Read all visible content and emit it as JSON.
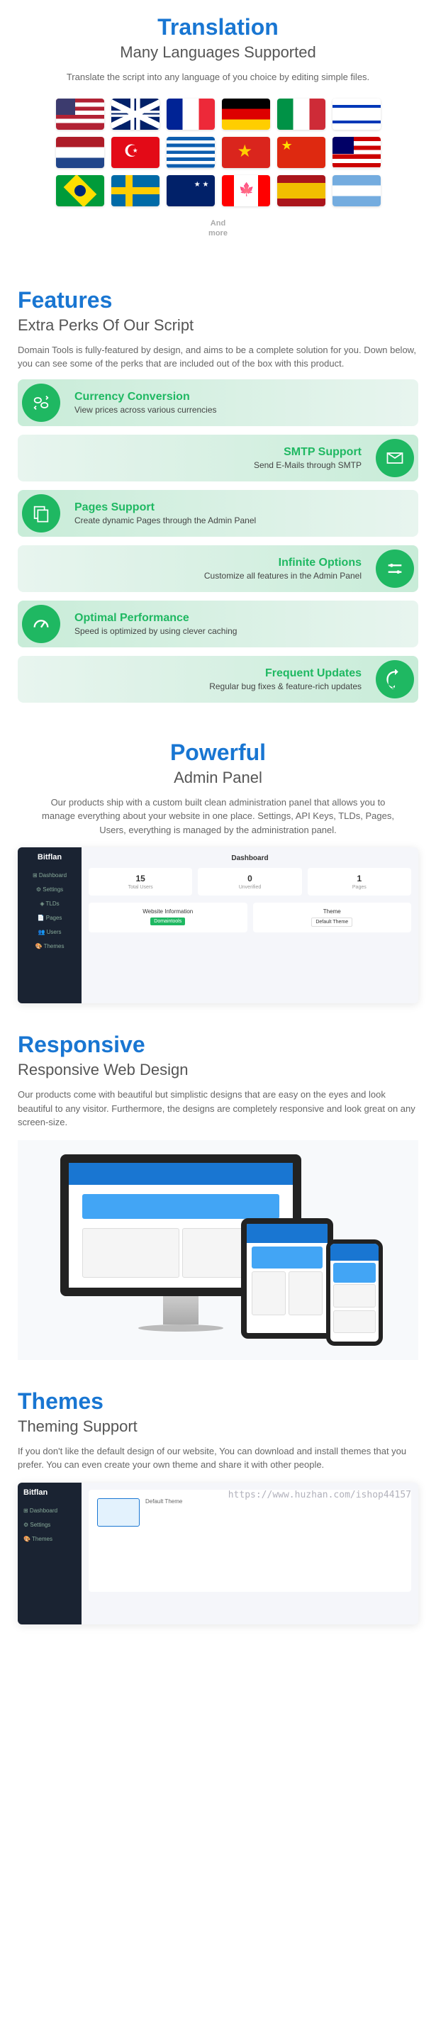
{
  "translation": {
    "title": "Translation",
    "subtitle": "Many Languages Supported",
    "desc": "Translate the script into any language of you choice by editing simple files.",
    "more1": "And",
    "more2": "more"
  },
  "features": {
    "title": "Features",
    "subtitle": "Extra Perks Of Our Script",
    "desc": "Domain Tools is fully-featured by design, and aims to be a complete solution for you. Down below, you can see some of the perks that are included out of the box with this product.",
    "items": [
      {
        "title": "Currency Conversion",
        "sub": "View prices across various currencies"
      },
      {
        "title": "SMTP Support",
        "sub": "Send E-Mails through SMTP"
      },
      {
        "title": "Pages Support",
        "sub": "Create dynamic Pages through the Admin Panel"
      },
      {
        "title": "Infinite Options",
        "sub": "Customize all features in the Admin Panel"
      },
      {
        "title": "Optimal Performance",
        "sub": "Speed is optimized by using clever caching"
      },
      {
        "title": "Frequent Updates",
        "sub": "Regular bug fixes & feature-rich updates"
      }
    ]
  },
  "powerful": {
    "title": "Powerful",
    "subtitle": "Admin Panel",
    "desc": "Our products ship with a custom built clean administration panel that allows you to manage everything about your website in one place. Settings, API Keys, TLDs, Pages, Users, everything is managed by the administration panel.",
    "logo": "Bitflan",
    "header": "Dashboard",
    "cards": [
      {
        "value": "15",
        "label": "Total Users"
      },
      {
        "value": "0",
        "label": "Unverified"
      },
      {
        "value": "1",
        "label": "Pages"
      }
    ],
    "box1_title": "Website Information",
    "box1_badge": "Domaintools",
    "box2_title": "Theme",
    "box2_badge": "Default Theme"
  },
  "responsive": {
    "title": "Responsive",
    "subtitle": "Responsive Web Design",
    "desc": "Our products come with beautiful but simplistic designs that are easy on the eyes and look beautiful to any visitor. Furthermore, the designs are completely responsive and look great on any screen-size."
  },
  "themes": {
    "title": "Themes",
    "subtitle": "Theming Support",
    "desc": "If you don't like the default design of our website, You can download and install themes that you prefer. You can even create your own theme and share it with other people.",
    "logo": "Bitflan",
    "watermark": "https://www.huzhan.com/ishop44157"
  }
}
